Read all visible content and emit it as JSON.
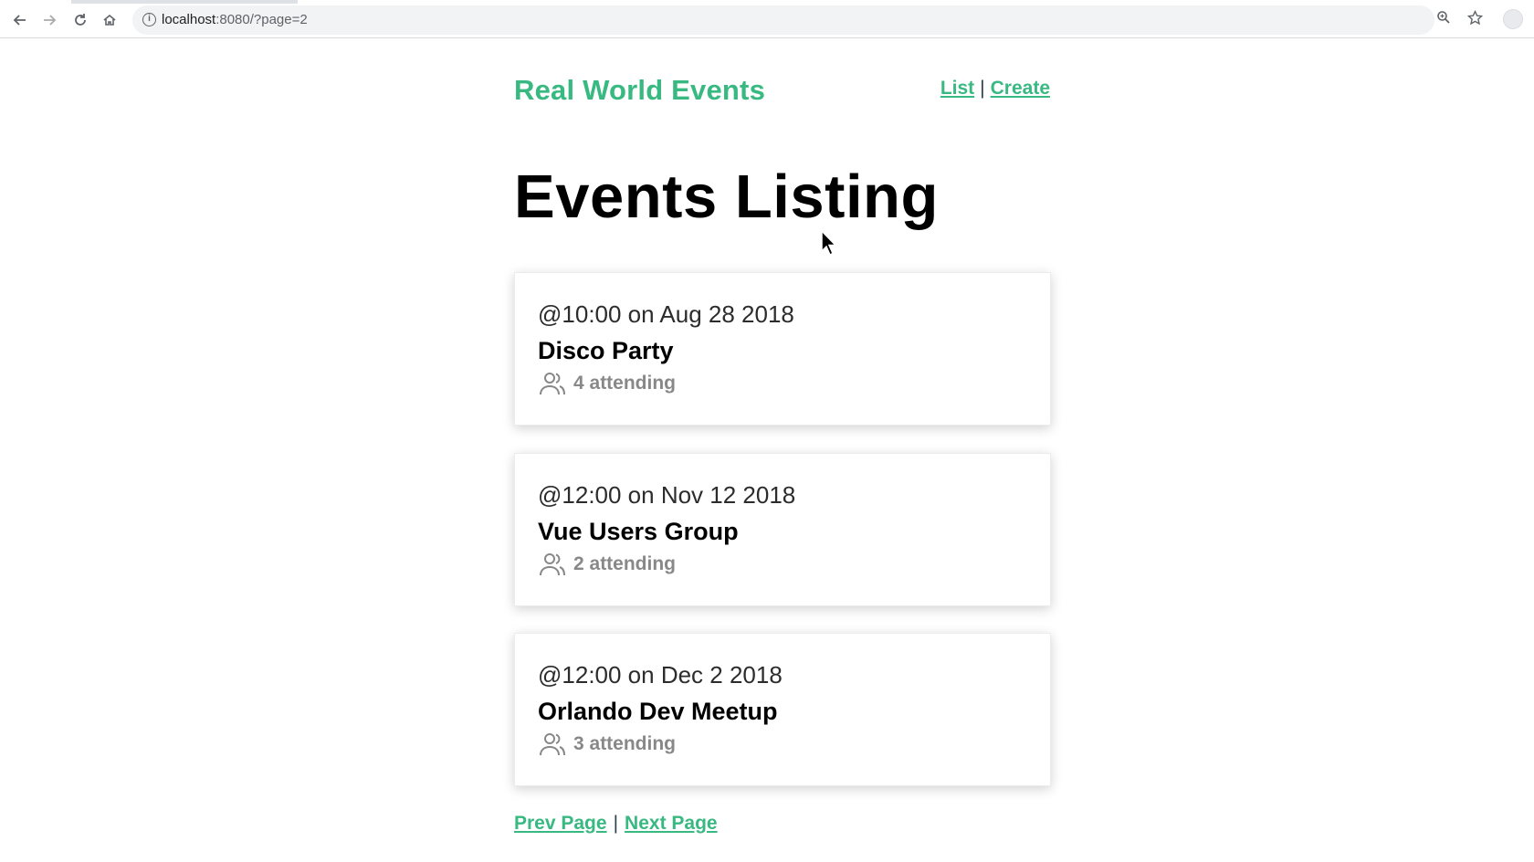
{
  "browser": {
    "url_host": "localhost",
    "url_rest": ":8080/?page=2"
  },
  "header": {
    "brand": "Real World Events",
    "nav": [
      {
        "label": "List"
      },
      {
        "label": "Create"
      }
    ],
    "separator": "|"
  },
  "page": {
    "title": "Events Listing"
  },
  "events": [
    {
      "date": "@10:00 on Aug 28 2018",
      "title": "Disco Party",
      "attending": "4 attending"
    },
    {
      "date": "@12:00 on Nov 12 2018",
      "title": "Vue Users Group",
      "attending": "2 attending"
    },
    {
      "date": "@12:00 on Dec 2 2018",
      "title": "Orlando Dev Meetup",
      "attending": "3 attending"
    }
  ],
  "pager": {
    "prev_label": "Prev Page",
    "next_label": "Next Page",
    "separator": "|"
  },
  "colors": {
    "brand": "#39b982",
    "text": "#000000",
    "muted": "#888888"
  }
}
